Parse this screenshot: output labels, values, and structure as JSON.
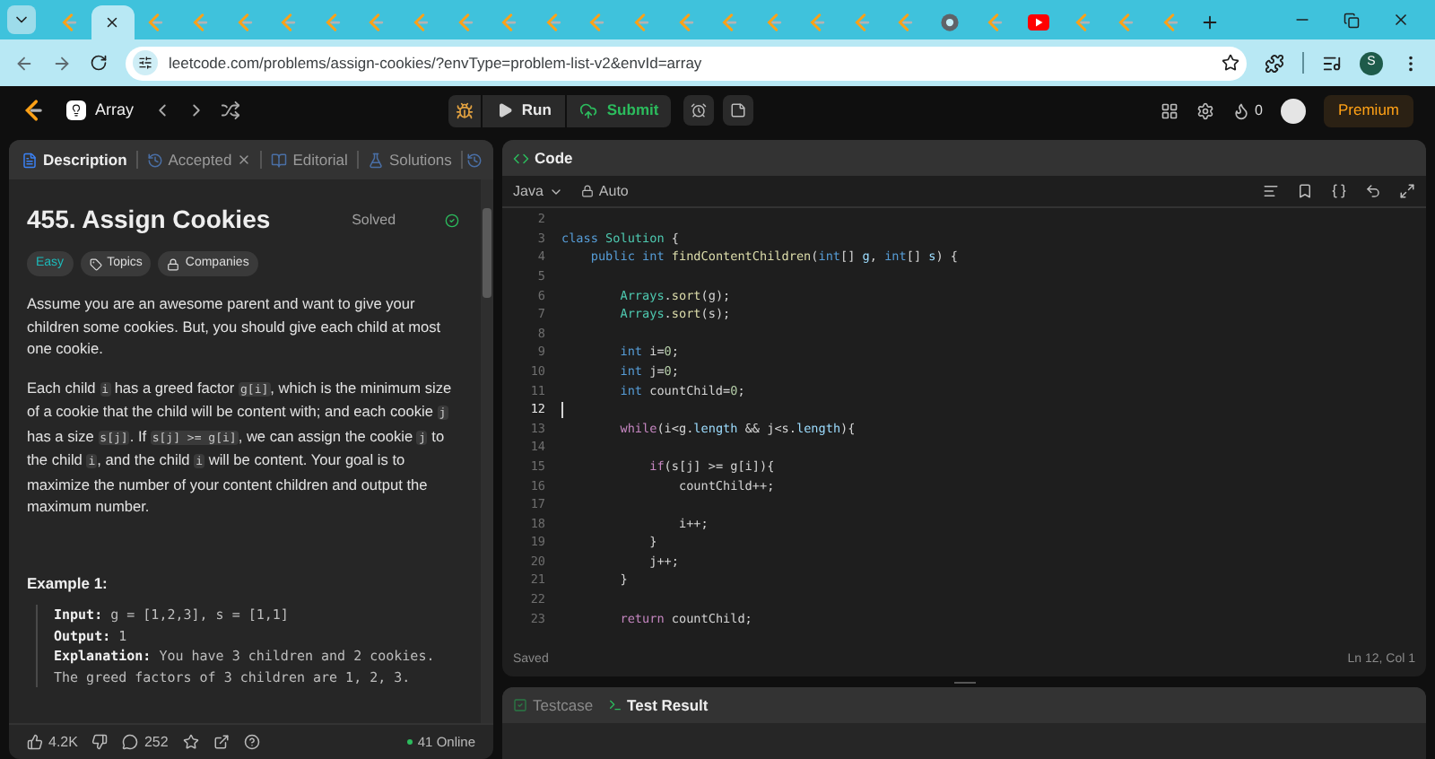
{
  "browser": {
    "tabs": [
      {
        "kind": "leetcode",
        "selected": false
      },
      {
        "selected": true
      },
      {
        "kind": "leetcode",
        "selected": false
      },
      {
        "kind": "leetcode",
        "selected": false
      },
      {
        "kind": "leetcode",
        "selected": false
      },
      {
        "kind": "leetcode",
        "selected": false
      },
      {
        "kind": "leetcode",
        "selected": false
      },
      {
        "kind": "leetcode",
        "selected": false
      },
      {
        "kind": "leetcode",
        "selected": false
      },
      {
        "kind": "leetcode",
        "selected": false
      },
      {
        "kind": "leetcode",
        "selected": false
      },
      {
        "kind": "leetcode",
        "selected": false
      },
      {
        "kind": "leetcode",
        "selected": false
      },
      {
        "kind": "leetcode",
        "selected": false
      },
      {
        "kind": "leetcode",
        "selected": false
      },
      {
        "kind": "leetcode",
        "selected": false
      },
      {
        "kind": "leetcode",
        "selected": false
      },
      {
        "kind": "leetcode",
        "selected": false
      },
      {
        "kind": "leetcode",
        "selected": false
      },
      {
        "kind": "leetcode",
        "selected": false
      },
      {
        "kind": "chrome",
        "selected": false
      },
      {
        "kind": "leetcode",
        "selected": false
      },
      {
        "kind": "youtube",
        "selected": false
      },
      {
        "kind": "leetcode",
        "selected": false
      },
      {
        "kind": "leetcode",
        "selected": false
      },
      {
        "kind": "leetcode",
        "selected": false
      }
    ],
    "url": "leetcode.com/problems/assign-cookies/?envType=problem-list-v2&envId=array",
    "profile_initial": "S"
  },
  "nav": {
    "list_name": "Array",
    "run": "Run",
    "submit": "Submit",
    "streak": "0",
    "premium": "Premium"
  },
  "left_tabs": [
    {
      "label": "Description",
      "selected": true,
      "closable": false
    },
    {
      "label": "Accepted",
      "selected": false,
      "closable": true
    },
    {
      "label": "Editorial",
      "selected": false,
      "closable": false
    },
    {
      "label": "Solutions",
      "selected": false,
      "closable": false
    }
  ],
  "problem": {
    "title": "455. Assign Cookies",
    "status": "Solved",
    "difficulty": "Easy",
    "tags": [
      "Topics",
      "Companies"
    ],
    "paragraphs": [
      [
        {
          "kind": "text",
          "text": "Assume you are an awesome parent and want to give your children some cookies. But, you should give each child at most one cookie."
        }
      ],
      [
        {
          "kind": "text",
          "text": "Each child "
        },
        {
          "kind": "code",
          "text": "i"
        },
        {
          "kind": "text",
          "text": " has a greed factor "
        },
        {
          "kind": "code",
          "text": "g[i]"
        },
        {
          "kind": "text",
          "text": ", which is the minimum size of a cookie that the child will be content with; and each cookie "
        },
        {
          "kind": "code",
          "text": "j"
        },
        {
          "kind": "text",
          "text": " has a size "
        },
        {
          "kind": "code",
          "text": "s[j]"
        },
        {
          "kind": "text",
          "text": ". If "
        },
        {
          "kind": "code",
          "text": "s[j] >= g[i]"
        },
        {
          "kind": "text",
          "text": ", we can assign the cookie "
        },
        {
          "kind": "code",
          "text": "j"
        },
        {
          "kind": "text",
          "text": " to the child "
        },
        {
          "kind": "code",
          "text": "i"
        },
        {
          "kind": "text",
          "text": ", and the child "
        },
        {
          "kind": "code",
          "text": "i"
        },
        {
          "kind": "text",
          "text": " will be content. Your goal is to maximize the number of your content children and output the maximum number."
        }
      ]
    ],
    "example_title": "Example 1:",
    "example": [
      {
        "label": "Input:",
        "value": "g = [1,2,3], s = [1,1]"
      },
      {
        "label": "Output:",
        "value": "1"
      },
      {
        "label": "Explanation:",
        "value": "You have 3 children and 2 cookies. The greed factors of 3 children are 1, 2, 3."
      }
    ]
  },
  "footer": {
    "likes": "4.2K",
    "comments": "252",
    "online": "41 Online"
  },
  "code": {
    "title": "Code",
    "language": "Java",
    "mode": "Auto",
    "status": "Saved",
    "cursor": "Ln 12, Col 1",
    "lines": [
      {
        "number": "2",
        "current": false
      },
      {
        "number": "3",
        "current": false,
        "tokens": [
          {
            "kind": "keyword",
            "text": "class"
          },
          {
            "kind": "type",
            "text": " Solution"
          },
          {
            "kind": "plain",
            "text": " {"
          }
        ]
      },
      {
        "number": "4",
        "current": false,
        "tokens": [
          {
            "kind": "keyword",
            "text": "    public"
          },
          {
            "kind": "keyword",
            "text": " int"
          },
          {
            "kind": "function",
            "text": " findContentChildren"
          },
          {
            "kind": "plain",
            "text": "("
          },
          {
            "kind": "keyword",
            "text": "int"
          },
          {
            "kind": "plain",
            "text": "[] "
          },
          {
            "kind": "variable",
            "text": "g"
          },
          {
            "kind": "plain",
            "text": ", "
          },
          {
            "kind": "keyword",
            "text": "int"
          },
          {
            "kind": "plain",
            "text": "[] "
          },
          {
            "kind": "variable",
            "text": "s"
          },
          {
            "kind": "plain",
            "text": ") {"
          }
        ]
      },
      {
        "number": "5",
        "current": false
      },
      {
        "number": "6",
        "current": false,
        "tokens": [
          {
            "kind": "type",
            "text": "        Arrays"
          },
          {
            "kind": "plain",
            "text": "."
          },
          {
            "kind": "function",
            "text": "sort"
          },
          {
            "kind": "plain",
            "text": "(g);"
          }
        ]
      },
      {
        "number": "7",
        "current": false,
        "tokens": [
          {
            "kind": "type",
            "text": "        Arrays"
          },
          {
            "kind": "plain",
            "text": "."
          },
          {
            "kind": "function",
            "text": "sort"
          },
          {
            "kind": "plain",
            "text": "(s);"
          }
        ]
      },
      {
        "number": "8",
        "current": false
      },
      {
        "number": "9",
        "current": false,
        "tokens": [
          {
            "kind": "keyword",
            "text": "        int"
          },
          {
            "kind": "plain",
            "text": " i="
          },
          {
            "kind": "number",
            "text": "0"
          },
          {
            "kind": "plain",
            "text": ";"
          }
        ]
      },
      {
        "number": "10",
        "current": false,
        "tokens": [
          {
            "kind": "keyword",
            "text": "        int"
          },
          {
            "kind": "plain",
            "text": " j="
          },
          {
            "kind": "number",
            "text": "0"
          },
          {
            "kind": "plain",
            "text": ";"
          }
        ]
      },
      {
        "number": "11",
        "current": false,
        "tokens": [
          {
            "kind": "keyword",
            "text": "        int"
          },
          {
            "kind": "plain",
            "text": " countChild="
          },
          {
            "kind": "number",
            "text": "0"
          },
          {
            "kind": "plain",
            "text": ";"
          }
        ]
      },
      {
        "number": "12",
        "current": true
      },
      {
        "number": "13",
        "current": false,
        "tokens": [
          {
            "kind": "control",
            "text": "        while"
          },
          {
            "kind": "plain",
            "text": "(i<g."
          },
          {
            "kind": "variable",
            "text": "length"
          },
          {
            "kind": "plain",
            "text": " && j<s."
          },
          {
            "kind": "variable",
            "text": "length"
          },
          {
            "kind": "plain",
            "text": "){"
          }
        ]
      },
      {
        "number": "14",
        "current": false
      },
      {
        "number": "15",
        "current": false,
        "tokens": [
          {
            "kind": "control",
            "text": "            if"
          },
          {
            "kind": "plain",
            "text": "(s[j] >= g[i]){"
          }
        ]
      },
      {
        "number": "16",
        "current": false,
        "tokens": [
          {
            "kind": "plain",
            "text": "                countChild++;"
          }
        ]
      },
      {
        "number": "17",
        "current": false
      },
      {
        "number": "18",
        "current": false,
        "tokens": [
          {
            "kind": "plain",
            "text": "                i++;"
          }
        ]
      },
      {
        "number": "19",
        "current": false,
        "tokens": [
          {
            "kind": "plain",
            "text": "            }"
          }
        ]
      },
      {
        "number": "20",
        "current": false,
        "tokens": [
          {
            "kind": "plain",
            "text": "            j++;"
          }
        ]
      },
      {
        "number": "21",
        "current": false,
        "tokens": [
          {
            "kind": "plain",
            "text": "        }"
          }
        ]
      },
      {
        "number": "22",
        "current": false
      },
      {
        "number": "23",
        "current": false,
        "tokens": [
          {
            "kind": "control",
            "text": "        return"
          },
          {
            "kind": "plain",
            "text": " countChild;"
          }
        ]
      }
    ]
  },
  "result_tabs": [
    {
      "label": "Testcase",
      "selected": false
    },
    {
      "label": "Test Result",
      "selected": true
    }
  ]
}
